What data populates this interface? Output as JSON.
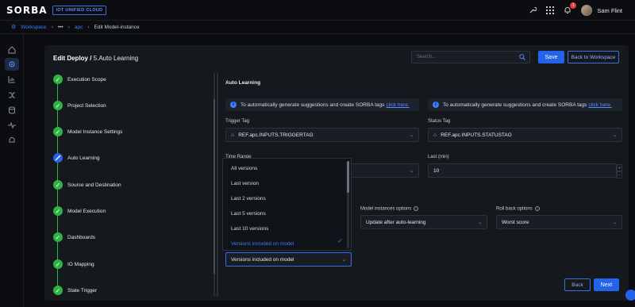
{
  "app": {
    "logo": "SORBA",
    "badge": "IOT UNIFIED CLOUD",
    "notification_count": "1",
    "user_name": "Sam Flint"
  },
  "breadcrumb": {
    "workspace": "Workspace",
    "dots": "•••",
    "apc": "apc",
    "current": "Edit Model-instance"
  },
  "header": {
    "title_prefix": "Edit Deploy / ",
    "title_step": "5.Auto Learning",
    "search_placeholder": "Search...",
    "save_label": "Save",
    "back_to_workspace_label": "Back to Workspace"
  },
  "steps": [
    {
      "label": "Execution Scope",
      "status": "done"
    },
    {
      "label": "Project Selection",
      "status": "done"
    },
    {
      "label": "Model Instance Settings",
      "status": "done"
    },
    {
      "label": "Auto Learning",
      "status": "current"
    },
    {
      "label": "Source and Destination",
      "status": "done"
    },
    {
      "label": "Model Execution",
      "status": "done"
    },
    {
      "label": "Dashboards",
      "status": "done"
    },
    {
      "label": "IO Mapping",
      "status": "done"
    },
    {
      "label": "State Trigger",
      "status": "done"
    }
  ],
  "form": {
    "section_title": "Auto Learning",
    "info_text": "To automatically generate suggestions and create SORBA tags",
    "info_link": "click here.",
    "trigger_tag_label": "Trigger Tag",
    "trigger_tag_value": "REF.apc.INPUTS.TRIGGERTAG",
    "status_tag_label": "Status Tag",
    "status_tag_value": "REF.apc.INPUTS.STATUSTAG",
    "time_range_label": "Time Range",
    "last_min_label": "Last (min)",
    "last_min_value": "10",
    "model_instances_options_label": "Model instances options",
    "model_instances_options_value": "Update after auto-learning",
    "roll_back_options_label": "Roll back options",
    "roll_back_options_value": "Worst score",
    "versions_value": "Versions included on model"
  },
  "dropdown": {
    "options": [
      "All versions",
      "Last version",
      "Last 2 versions",
      "Last 5 versions",
      "Last 10 versions",
      "Versions included on model"
    ],
    "selected": "Versions included on model"
  },
  "footer": {
    "back_label": "Back",
    "next_label": "Next"
  },
  "icons": {
    "wrench": "wrench-icon",
    "apps": "apps-grid-icon",
    "bell": "bell-icon",
    "search": "search-icon",
    "info": "info-icon",
    "tag": "tag-icon"
  },
  "colors": {
    "accent": "#2563eb",
    "success": "#2fb344",
    "link": "#3d7bff",
    "background": "#0b0d10",
    "card": "#15181d"
  }
}
